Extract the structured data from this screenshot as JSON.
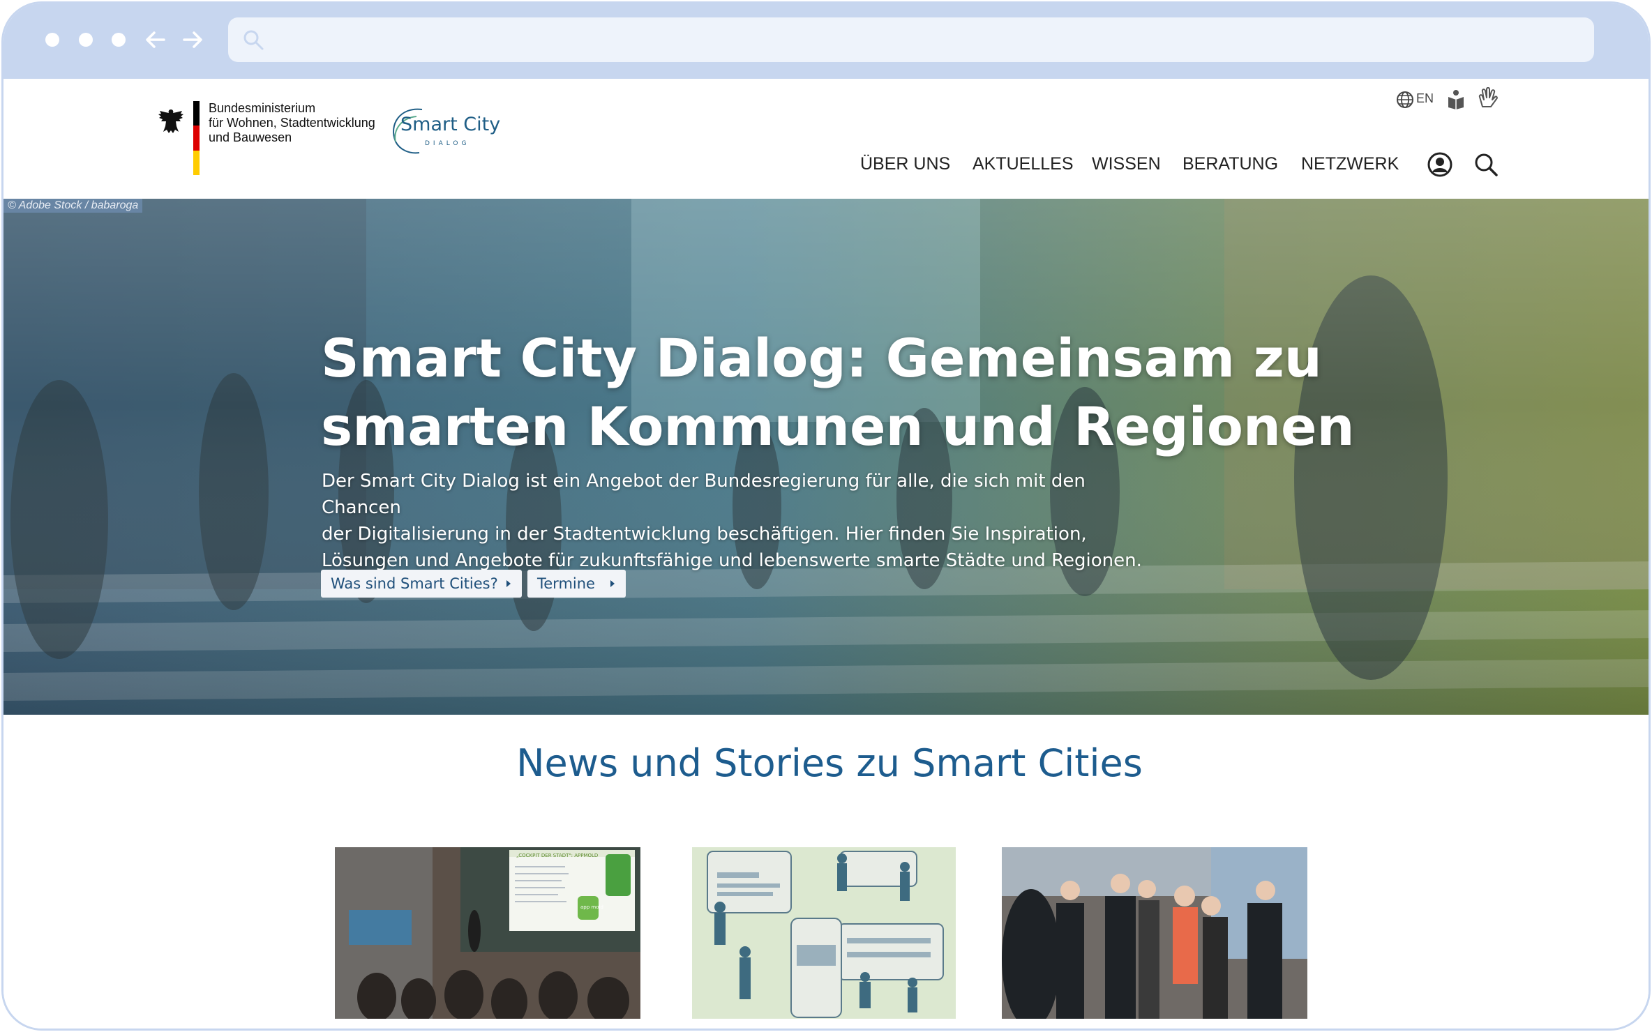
{
  "browser": {
    "address_value": ""
  },
  "header": {
    "ministry_lines": [
      "Bundesministerium",
      "für Wohnen, Stadtentwicklung",
      "und Bauwesen"
    ],
    "logo_title": "Smart City",
    "logo_subtitle": "DIALOG",
    "language": "EN",
    "nav": [
      "ÜBER UNS",
      "AKTUELLES",
      "WISSEN",
      "BERATUNG",
      "NETZWERK"
    ]
  },
  "hero": {
    "credit": "© Adobe Stock / babaroga",
    "title_line1": "Smart City Dialog: Gemeinsam zu",
    "title_line2": "smarten Kommunen und Regionen",
    "text_lines": [
      "Der Smart City Dialog ist ein Angebot der Bundesregierung für alle, die sich mit den Chancen",
      "der Digitalisierung in der Stadtentwicklung beschäftigen. Hier finden Sie Inspiration,",
      "Lösungen und Angebote für zukunftsfähige und lebenswerte smarte Städte und Regionen."
    ],
    "buttons": [
      "Was sind Smart Cities?",
      "Termine"
    ]
  },
  "news": {
    "title": "News und Stories zu Smart Cities",
    "card1_screen_title": "„COCKPIT DER STADT\": APPMOLD",
    "card1_badge": "app mold"
  },
  "colors": {
    "chrome": "#c7d6ef",
    "accent": "#1d5c8e",
    "flag_black": "#000000",
    "flag_red": "#dd0000",
    "flag_gold": "#ffcc00"
  }
}
